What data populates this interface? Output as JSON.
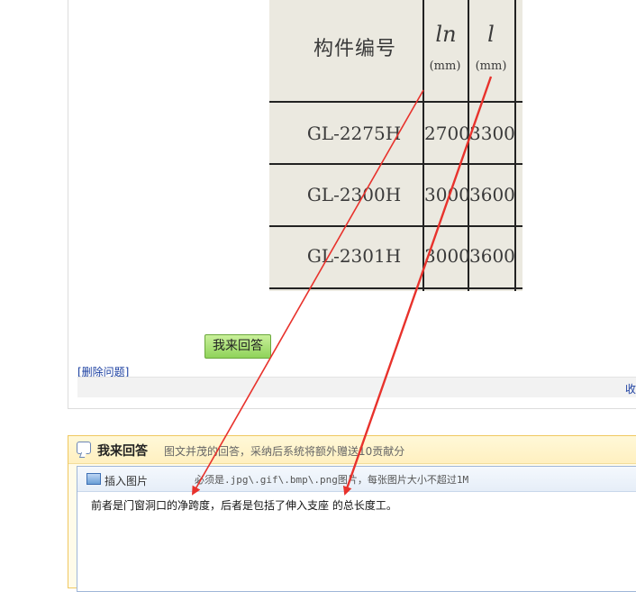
{
  "question": {
    "table": {
      "header": {
        "col1": "构件编号",
        "sym_ln": "ln",
        "sym_l": "l",
        "unit1": "(mm)",
        "unit2": "(mm)"
      },
      "rows": [
        {
          "code": "GL-2275H",
          "ln": "2700",
          "l": "3300"
        },
        {
          "code": "GL-2300H",
          "ln": "3000",
          "l": "3600"
        },
        {
          "code": "GL-2301H",
          "ln": "3000",
          "l": "3600"
        }
      ]
    },
    "answer_button": "我来回答",
    "delete_link": "[删除问题]",
    "collect_label": "收"
  },
  "answer_panel": {
    "title": "我来回答",
    "subtitle": "图文并茂的回答，采纳后系统将额外赠送10贡献分",
    "insert_image_label": "插入图片",
    "upload_hint": "必须是.jpg\\.gif\\.bmp\\.png图片，每张图片大小不超过1M",
    "editor_text": "前者是门窗洞口的净跨度，后者是包括了伸入支座 的总长度工。"
  },
  "colors": {
    "arrow": "#e8322c",
    "button_green": "#8fd35a",
    "panel_border": "#f0c860"
  }
}
